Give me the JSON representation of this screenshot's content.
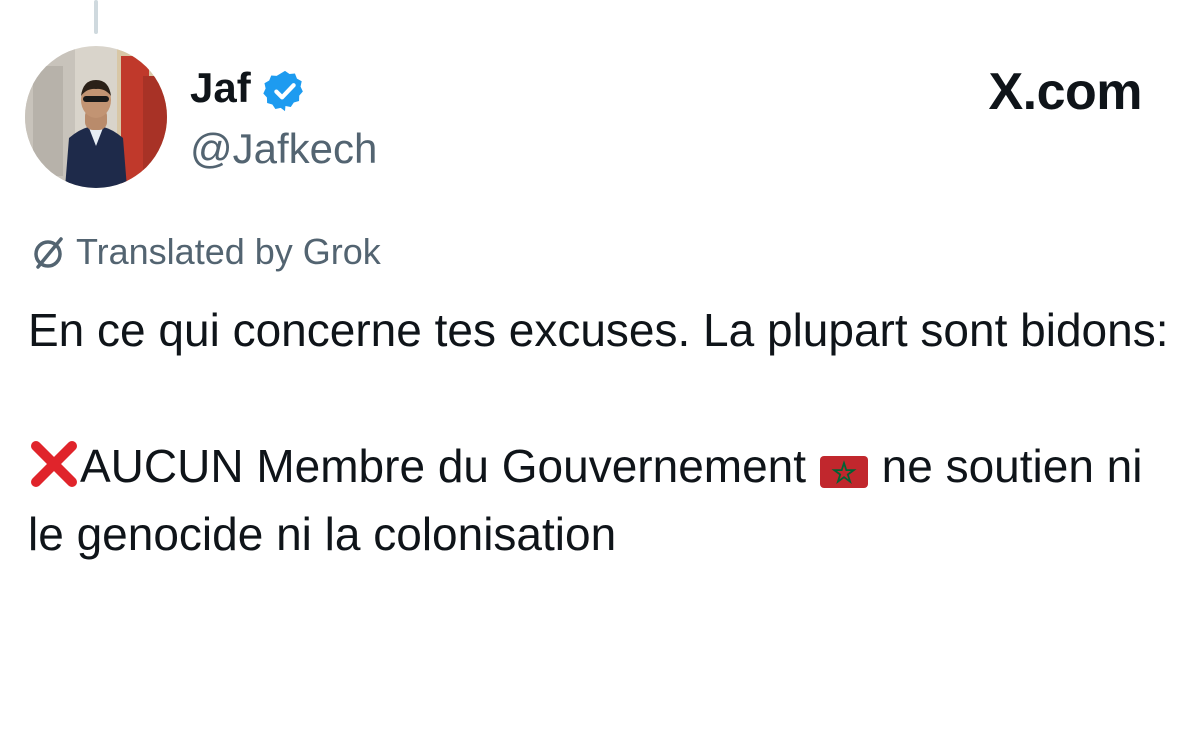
{
  "tweet": {
    "author": {
      "name": "Jaf",
      "handle": "@Jafkech",
      "verified": true
    },
    "site": "X.com",
    "translation_label": "Translated by Grok",
    "body": {
      "line1": "En ce qui concerne tes excuses. La plupart sont bidons:",
      "item_before_flag": "AUCUN Membre du Gouvernement",
      "item_after_flag": "ne soutien ni le genocide ni la colonisation"
    }
  },
  "colors": {
    "text": "#0f1419",
    "secondary_text": "#536471",
    "verified_badge": "#1d9bf0",
    "cross_emoji": "#e0242b",
    "flag_red": "#c1272d",
    "flag_star": "#006233"
  },
  "icons": {
    "verified": "verified-badge-icon",
    "translate": "grok-slashed-circle-icon",
    "cross": "red-cross-mark-emoji",
    "flag": "morocco-flag-emoji"
  }
}
